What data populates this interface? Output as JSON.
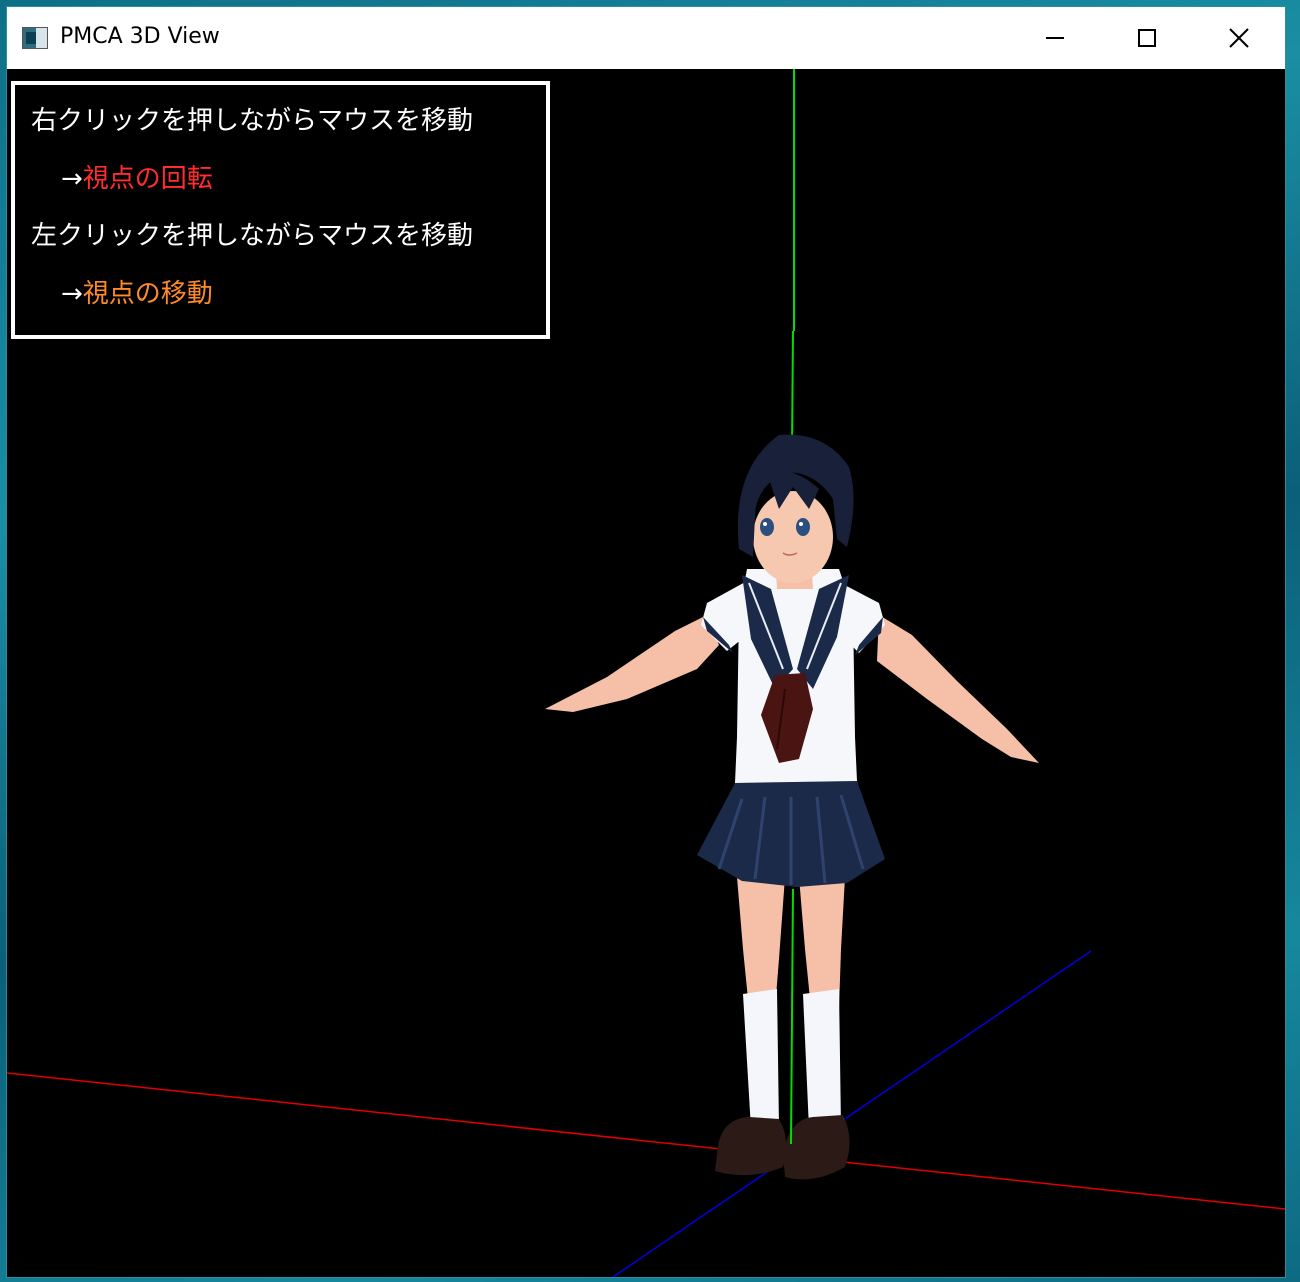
{
  "window": {
    "title": "PMCA 3D View",
    "icon": "app-window-icon",
    "controls": [
      "minimize-icon",
      "maximize-icon",
      "close-icon"
    ]
  },
  "help": {
    "line1": "右クリックを押しながらマウスを移動",
    "line2_arrow": "→",
    "line2_action": "視点の回転",
    "line3": "左クリックを押しながらマウスを移動",
    "line4_arrow": "→",
    "line4_action": "視点の移動"
  },
  "colors": {
    "rotate_text": "#ff2d2d",
    "move_text": "#ff8a2a",
    "x_axis": "#e00000",
    "y_axis": "#00dd00",
    "z_axis": "#0000e0",
    "background": "#000000"
  },
  "scene": {
    "axes": [
      "x-axis",
      "y-axis",
      "z-axis"
    ],
    "model": "schoolgirl-character-model"
  }
}
